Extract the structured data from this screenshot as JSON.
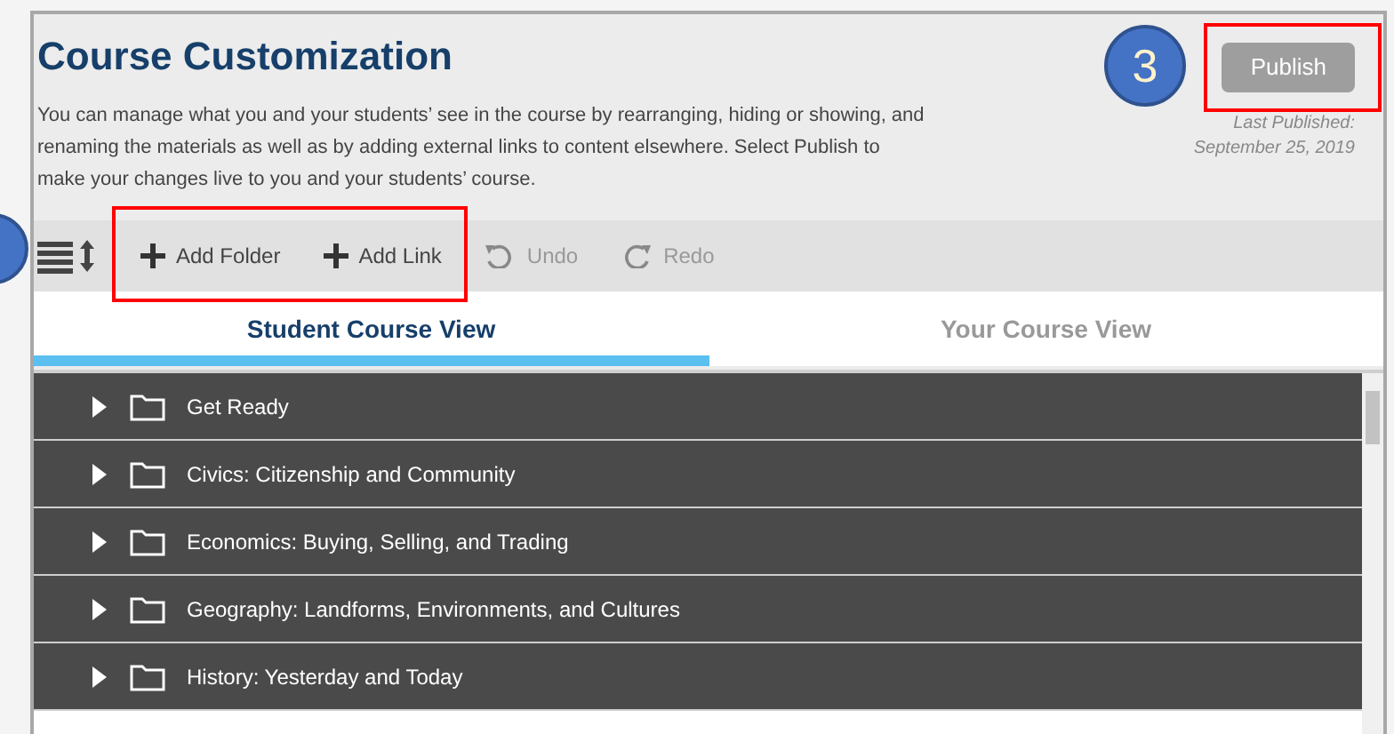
{
  "header": {
    "title": "Course Customization",
    "description": "You can manage what you and your students’ see in the course by rearranging, hiding or showing, and renaming the materials as well as by adding external links to content elsewhere. Select Publish to make your changes live to you and your students’ course.",
    "publish_button": "Publish",
    "publish_disabled": true,
    "last_published_label": "Last Published:",
    "last_published_date": "September 25, 2019"
  },
  "callouts": [
    {
      "label": "3"
    }
  ],
  "toolbar": [
    {
      "kind": "add",
      "label": "Add Folder",
      "disabled": false
    },
    {
      "kind": "add",
      "label": "Add Link",
      "disabled": false
    },
    {
      "kind": "undo",
      "label": "Undo",
      "disabled": true
    },
    {
      "kind": "redo",
      "label": "Redo",
      "disabled": true
    }
  ],
  "tabs": [
    {
      "label": "Student Course View",
      "selected": true
    },
    {
      "label": "Your Course View",
      "selected": false
    }
  ],
  "folders": [
    {
      "name": "Get Ready",
      "expanded": false
    },
    {
      "name": "Civics: Citizenship and Community",
      "expanded": false
    },
    {
      "name": "Economics: Buying, Selling, and Trading",
      "expanded": false
    },
    {
      "name": "Geography: Landforms, Environments, and Cultures",
      "expanded": false
    },
    {
      "name": "History: Yesterday and Today",
      "expanded": false
    }
  ]
}
